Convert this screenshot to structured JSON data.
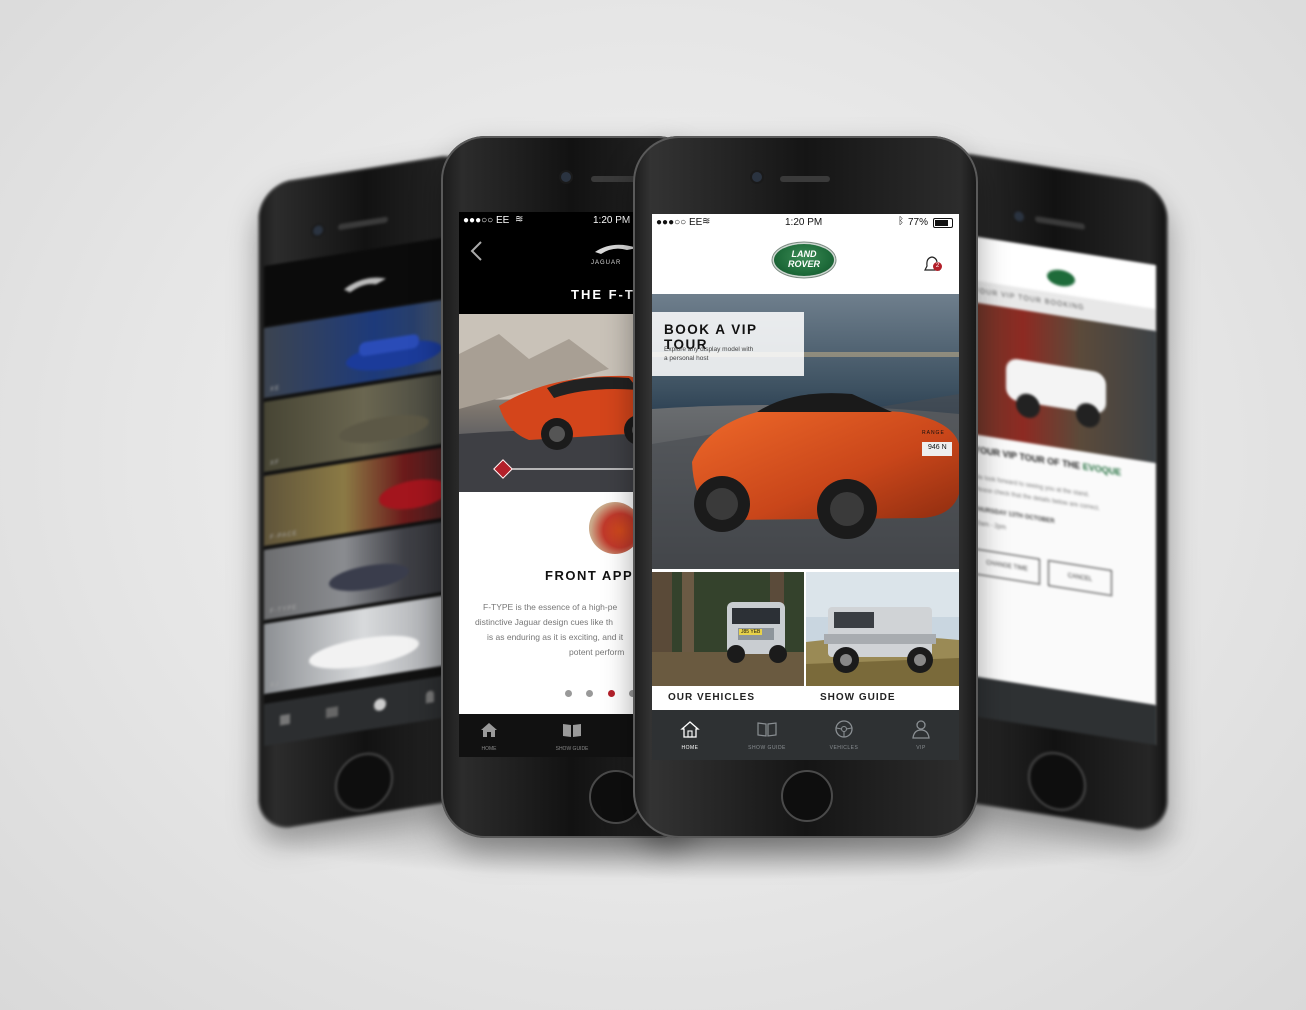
{
  "colors": {
    "background": "#e6e6e6",
    "landrover_green": "#1e6b3a",
    "jaguar_red": "#b3202a",
    "tabbar_dark": "#2e3133"
  },
  "jaguar_phone": {
    "status": {
      "carrier": "●●●○○ EE",
      "time": "1:20 PM"
    },
    "brand": "JAGUAR",
    "page_title": "THE F-T",
    "section_title": "FRONT APP",
    "body_lines": [
      "F-TYPE is the essence of a high-pe",
      "distinctive Jaguar design cues like th",
      "is as enduring as it is exciting, and it",
      "potent perform"
    ],
    "pager_active_index": 2,
    "tabs": [
      {
        "label": "HOME",
        "icon": "home-icon"
      },
      {
        "label": "SHOW GUIDE",
        "icon": "book-icon"
      }
    ]
  },
  "landrover_phone": {
    "status": {
      "carrier": "●●●○○ EE",
      "time": "1:20 PM",
      "battery": "77%"
    },
    "logo_line1": "LAND",
    "logo_line2": "ROVER",
    "notification_count": "2",
    "hero": {
      "title": "BOOK A VIP TOUR",
      "subtitle_line1": "Explore any display model with",
      "subtitle_line2": "a personal host",
      "car_badge": "RANGE",
      "plate": "946 N"
    },
    "tiles": [
      {
        "label": "OUR VEHICLES",
        "plate": "J85 YEB"
      },
      {
        "label": "SHOW GUIDE"
      }
    ],
    "tabs": [
      {
        "label": "HOME",
        "icon": "home-icon",
        "active": true
      },
      {
        "label": "SHOW GUIDE",
        "icon": "book-icon",
        "active": false
      },
      {
        "label": "VEHICLES",
        "icon": "steering-wheel-icon",
        "active": false
      },
      {
        "label": "VIP",
        "icon": "person-icon",
        "active": false
      }
    ]
  },
  "back_left_phone": {
    "rows": [
      "XE",
      "XF",
      "F-PACE",
      "F-TYPE",
      "XJ"
    ]
  },
  "back_right_phone": {
    "header": "YOUR VIP TOUR BOOKING",
    "heading_prefix": "YOUR VIP TOUR OF THE",
    "heading_model": "EVOQUE",
    "text_line1": "We look forward to seeing you at the stand.",
    "text_line2": "Please check that the details below are correct.",
    "date": "THURSDAY 13TH OCTOBER",
    "time": "10am - 2pm",
    "change_label": "CHANGE TIME",
    "cancel_label": "CANCEL"
  }
}
